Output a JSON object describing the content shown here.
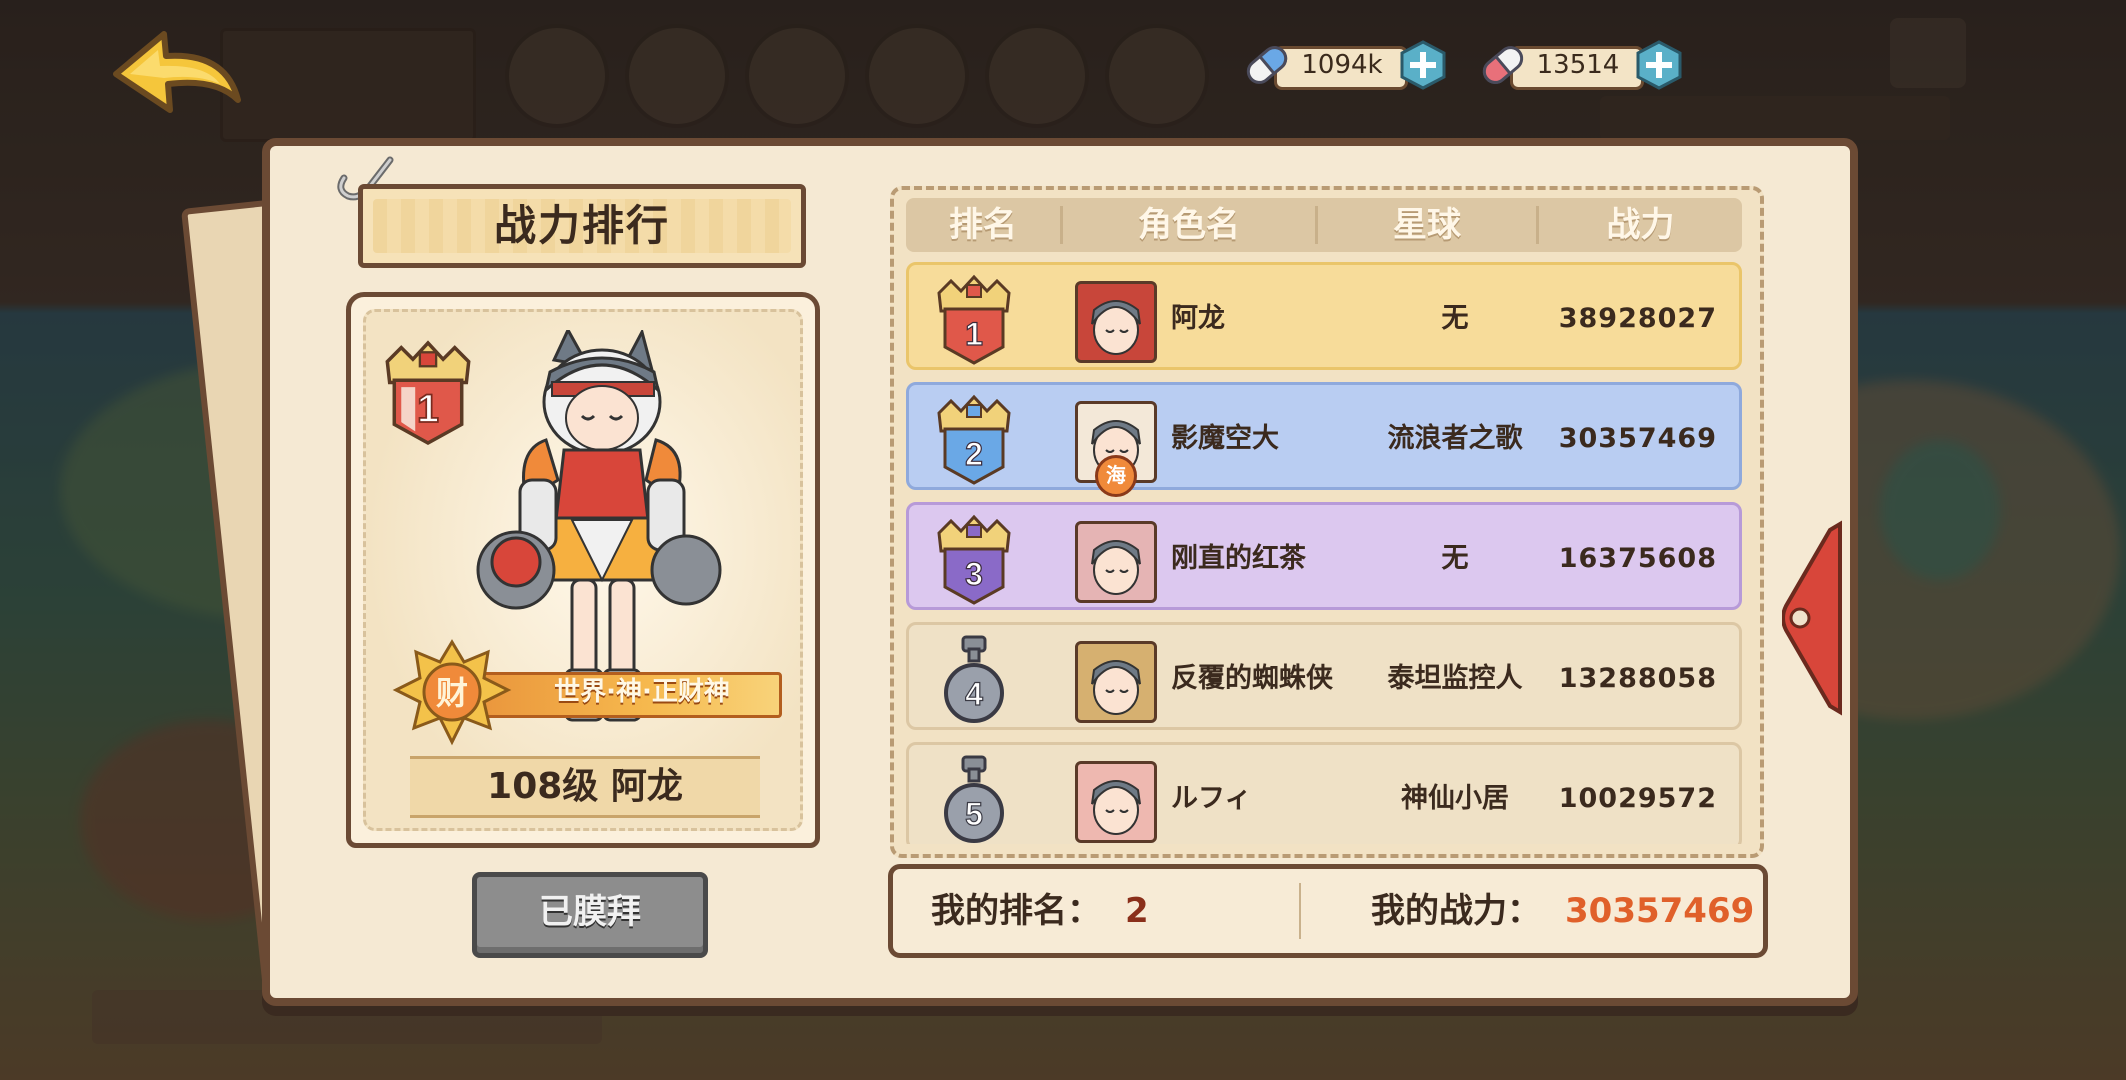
{
  "colors": {
    "rank1_row": "#f7dc9a",
    "rank2_row": "#b9cdf2",
    "rank3_row": "#dcc8ef",
    "rank_default_row": "#efe1c6",
    "my_power_color": "#e0602a",
    "my_rank_color": "#8a2f1a"
  },
  "currencies": [
    {
      "icon": "blue-pill-icon",
      "amount": "1094k"
    },
    {
      "icon": "red-pill-icon",
      "amount": "13514"
    }
  ],
  "panel": {
    "title": "战力排行"
  },
  "featured": {
    "rank": "1",
    "title_badge_char": "财",
    "title_text": "世界·神·正财神",
    "level_name": "108级  阿龙",
    "worship_button": "已膜拜"
  },
  "leaderboard": {
    "headers": {
      "rank": "排名",
      "name": "角色名",
      "planet": "星球",
      "power": "战力"
    },
    "rows": [
      {
        "rank": "1",
        "name": "阿龙",
        "planet": "无",
        "power": "38928027",
        "row_style": "gold"
      },
      {
        "rank": "2",
        "name": "影魔空大",
        "planet": "流浪者之歌",
        "power": "30357469",
        "row_style": "blue",
        "avatar_badge": "海"
      },
      {
        "rank": "3",
        "name": "刚直的红茶",
        "planet": "无",
        "power": "16375608",
        "row_style": "purple"
      },
      {
        "rank": "4",
        "name": "反覆的蜘蛛侠",
        "planet": "泰坦监控人",
        "power": "13288058",
        "row_style": "plain"
      },
      {
        "rank": "5",
        "name": "ルフィ",
        "planet": "神仙小居",
        "power": "10029572",
        "row_style": "plain"
      }
    ]
  },
  "my": {
    "rank_label": "我的排名：",
    "rank_value": "2",
    "power_label": "我的战力：",
    "power_value": "30357469"
  }
}
